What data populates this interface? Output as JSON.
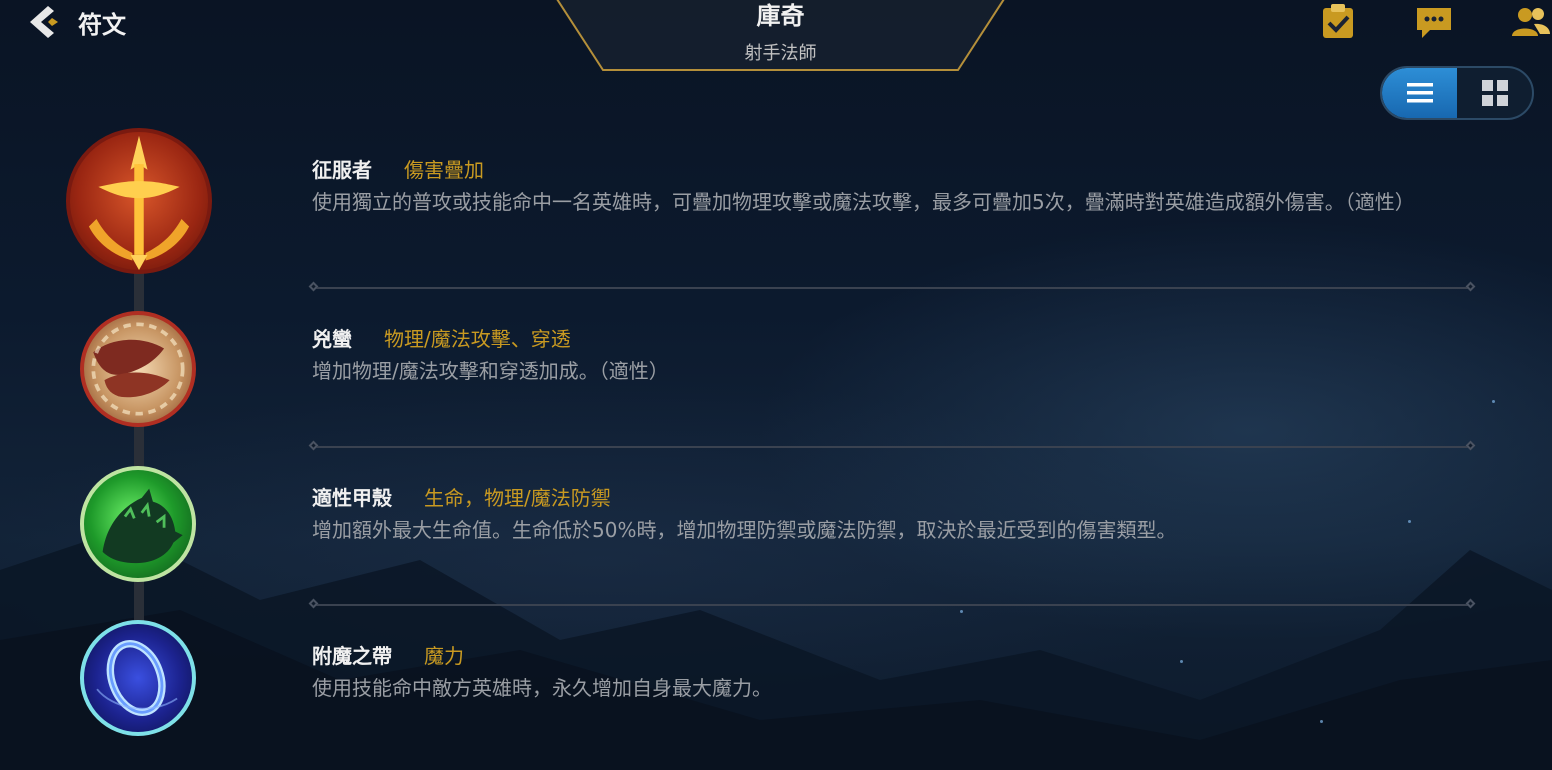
{
  "header": {
    "back_label": "符文",
    "champion_name": "庫奇",
    "champion_role": "射手法師"
  },
  "icons": {
    "back": "chevron-left-icon",
    "tasks": "clipboard-check-icon",
    "chat": "chat-bubble-icon",
    "friends": "friends-icon",
    "list_view": "list-view-icon",
    "grid_view": "grid-view-icon"
  },
  "view_toggle": {
    "selected": "list"
  },
  "colors": {
    "accent_gold": "#c99a21",
    "toggle_active": "#1f78c2"
  },
  "runes": [
    {
      "name": "征服者",
      "tag": "傷害疊加",
      "description": "使用獨立的普攻或技能命中一名英雄時，可疊加物理攻擊或魔法攻擊，最多可疊加5次，疊滿時對英雄造成額外傷害。（適性）",
      "icon": "conqueror-rune-icon"
    },
    {
      "name": "兇蠻",
      "tag": "物理/魔法攻擊、穿透",
      "description": "增加物理/魔法攻擊和穿透加成。（適性）",
      "icon": "brutal-rune-icon"
    },
    {
      "name": "適性甲殼",
      "tag": "生命，物理/魔法防禦",
      "description": "增加額外最大生命值。生命低於50%時，增加物理防禦或魔法防禦，取決於最近受到的傷害類型。",
      "icon": "adaptive-carapace-rune-icon"
    },
    {
      "name": "附魔之帶",
      "tag": "魔力",
      "description": "使用技能命中敵方英雄時，永久增加自身最大魔力。",
      "icon": "enchanted-band-rune-icon"
    }
  ]
}
